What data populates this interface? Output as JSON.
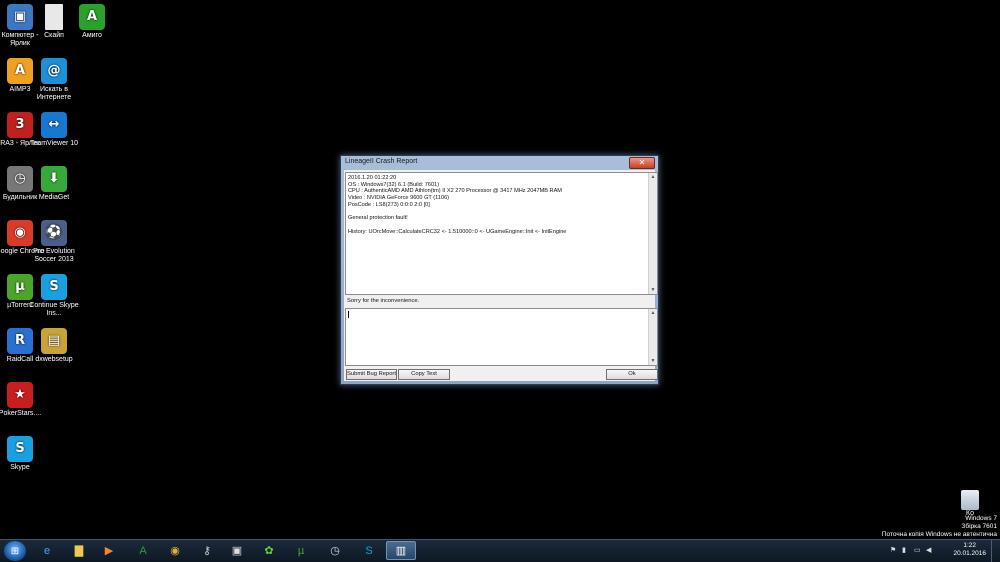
{
  "desktop": {
    "icons": [
      {
        "label": "Компютер - Ярлик",
        "icon": "computer-icon",
        "color": "#3a78c2",
        "glyph": "▣"
      },
      {
        "label": "Скайп",
        "icon": "blank-file-icon",
        "color": "#e8e8e8",
        "glyph": ""
      },
      {
        "label": "Амиго",
        "icon": "amigo-icon",
        "color": "#2aa12a",
        "glyph": "A"
      },
      {
        "label": "AIMP3",
        "icon": "aimp-icon",
        "color": "#f0a020",
        "glyph": "A"
      },
      {
        "label": "Искать в Интернете",
        "icon": "mail-at-icon",
        "color": "#1e8fd8",
        "glyph": "@"
      },
      {
        "label": "RA3 - Ярлик",
        "icon": "ra3-icon",
        "color": "#c02020",
        "glyph": "3"
      },
      {
        "label": "TeamViewer 10",
        "icon": "teamviewer-icon",
        "color": "#1678d0",
        "glyph": "↔"
      },
      {
        "label": "Будильник",
        "icon": "alarm-clock-icon",
        "color": "#777777",
        "glyph": "◷"
      },
      {
        "label": "MediaGet",
        "icon": "mediaget-icon",
        "color": "#39a83a",
        "glyph": "⬇"
      },
      {
        "label": "Google Chrome",
        "icon": "chrome-icon",
        "color": "#d93a2a",
        "glyph": "◉"
      },
      {
        "label": "Pro Evolution Soccer 2013",
        "icon": "pes-icon",
        "color": "#4b5f8a",
        "glyph": "⚽"
      },
      {
        "label": "µTorrent",
        "icon": "utorrent-icon",
        "color": "#4aa52a",
        "glyph": "µ"
      },
      {
        "label": "Continue Skype Ins...",
        "icon": "skype-installer-icon",
        "color": "#1aa0e0",
        "glyph": "S"
      },
      {
        "label": "RaidCall",
        "icon": "raidcall-icon",
        "color": "#2a70d0",
        "glyph": "R"
      },
      {
        "label": "dxwebsetup",
        "icon": "dxwebsetup-icon",
        "color": "#c8a23a",
        "glyph": "▤"
      },
      {
        "label": "PokerStars....",
        "icon": "pokerstars-icon",
        "color": "#c81e1e",
        "glyph": "★"
      },
      {
        "label": "Skype",
        "icon": "skype-icon",
        "color": "#1aa0e0",
        "glyph": "S"
      }
    ],
    "recycle_label": "Ко"
  },
  "window": {
    "title": "LineageII Crash Report",
    "close_glyph": "✕",
    "report_lines": [
      "2016.1.20 01:22:20",
      "OS : Windows7(32) 6.1 (Build: 7601)",
      "CPU : AuthenticAMD  AMD Athlon(tm) II X2 270 Processor @ 3417 MHz 2047MB RAM",
      "Video : NVIDIA GeForce 9600 GT (1106)",
      "PosCode : LS8(273) 0:0:0 2:0 [0]",
      "",
      "General protection fault!",
      "",
      "History: UOrcMove::CalculateCRC32 <- 1.510000::0 <- UGameEngine::Init <- InitEngine"
    ],
    "sorry_text": "Sorry for the inconvenience.",
    "input_value": "",
    "buttons": {
      "submit": "Submit Bug Report",
      "copy": "Copy Text",
      "ok": "Ok"
    }
  },
  "taskbar": {
    "pinned": [
      {
        "icon": "ie-icon",
        "glyph": "e",
        "color": "#4aa3ff"
      },
      {
        "icon": "explorer-folder-icon",
        "glyph": "▇",
        "color": "#f0c850"
      },
      {
        "icon": "media-player-icon",
        "glyph": "▶",
        "color": "#f08a20"
      },
      {
        "icon": "amigo-taskbar-icon",
        "glyph": "A",
        "color": "#2aa12a"
      },
      {
        "icon": "chrome-taskbar-icon",
        "glyph": "◉",
        "color": "#e0b030"
      },
      {
        "icon": "keys-icon",
        "glyph": "⚷",
        "color": "#cccccc"
      },
      {
        "icon": "window-app-icon",
        "glyph": "▣",
        "color": "#dddddd"
      },
      {
        "icon": "icq-icon",
        "glyph": "✿",
        "color": "#6ad02a"
      },
      {
        "icon": "utorrent-taskbar-icon",
        "glyph": "µ",
        "color": "#4aa52a"
      },
      {
        "icon": "clock-app-icon",
        "glyph": "◷",
        "color": "#dddddd"
      },
      {
        "icon": "skype-taskbar-icon",
        "glyph": "S",
        "color": "#1aa0e0"
      },
      {
        "icon": "lineage-running-icon",
        "glyph": "▥",
        "color": "#ffffff"
      }
    ],
    "clock_time": "1:22",
    "clock_date": "20.01.2016"
  },
  "watermark": {
    "line1": "Windows 7",
    "line2": "Збірка 7601",
    "line3": "Поточна копія Windows не автентична"
  }
}
